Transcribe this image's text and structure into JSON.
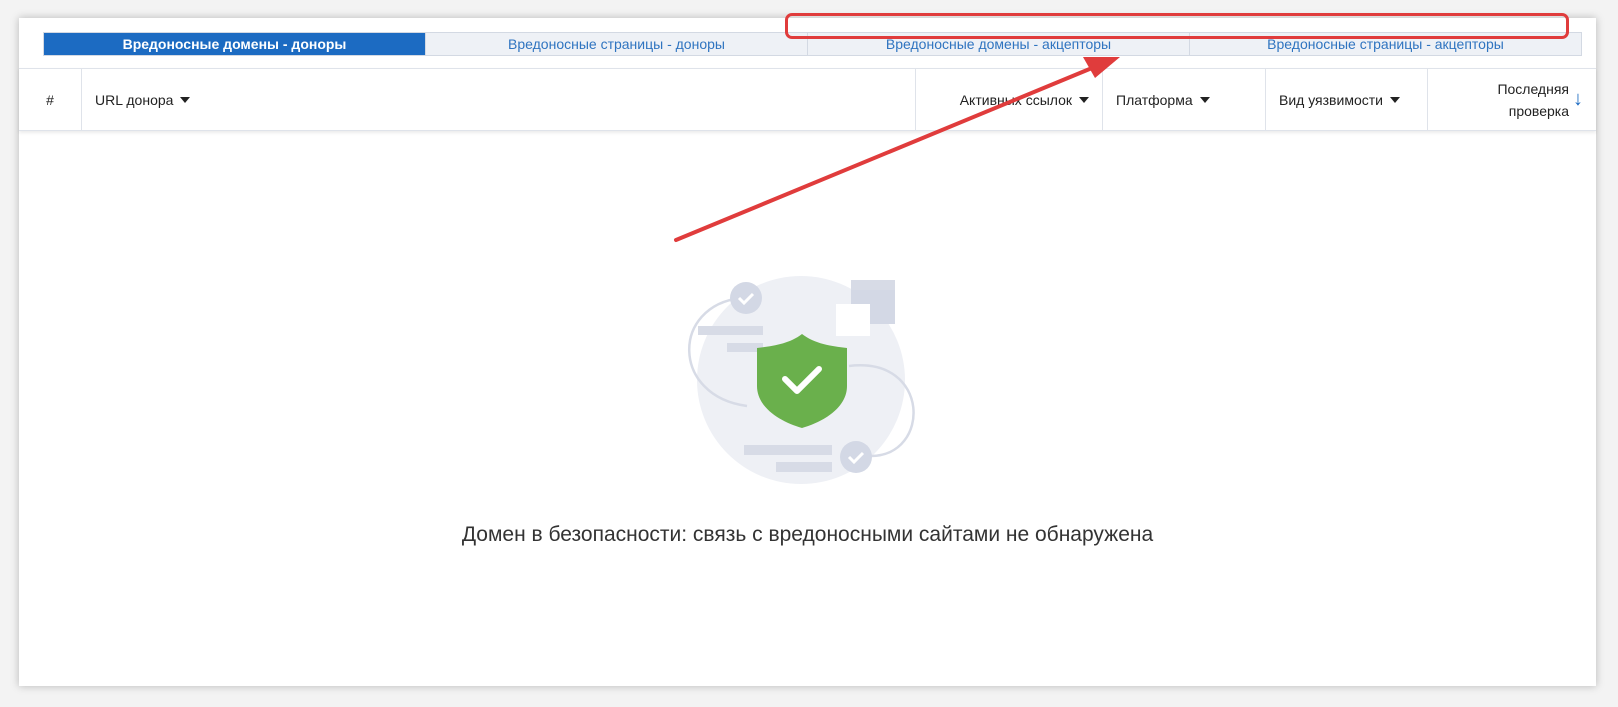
{
  "tabs": [
    {
      "label": "Вредоносные домены - доноры",
      "active": true
    },
    {
      "label": "Вредоносные страницы - доноры",
      "active": false
    },
    {
      "label": "Вредоносные домены - акцепторы",
      "active": false
    },
    {
      "label": "Вредоносные страницы - акцепторы",
      "active": false
    }
  ],
  "table": {
    "columns": {
      "num": "#",
      "url": "URL донора",
      "active_links": "Активных ссылок",
      "platform": "Платформа",
      "vuln_type": "Вид уязвимости",
      "last_check_line1": "Последняя",
      "last_check_line2": "проверка"
    },
    "sort_icon": "arrow-down-icon"
  },
  "empty_state": {
    "message": "Домен в безопасности: связь с вредоносными сайтами не обнаружена",
    "icon": "shield-check-icon"
  },
  "colors": {
    "accent": "#1c6bc2",
    "annotation": "#e03c3c",
    "shield": "#6ab04c"
  }
}
